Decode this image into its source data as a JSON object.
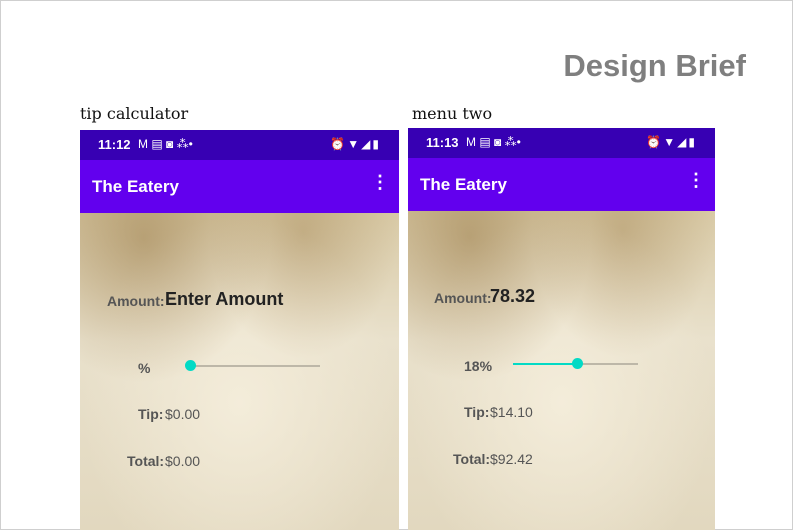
{
  "title": "Design Brief",
  "captions": {
    "left": "tip calculator",
    "right": "menu two"
  },
  "phones": [
    {
      "time": "11:12",
      "notif_icons": "M ▤ ◙ ⁂•",
      "sys_icons": "⏰▼◢▮",
      "app_title": "The Eatery",
      "menu_icon": "⋮",
      "amount_label": "Amount:",
      "amount_value": "Enter Amount",
      "percent_label": "%",
      "slider_fraction": 0,
      "tip_label": "Tip:",
      "tip_value": "$0.00",
      "total_label": "Total:",
      "total_value": "$0.00"
    },
    {
      "time": "11:13",
      "notif_icons": "M ▤ ◙ ⁂•",
      "sys_icons": "⏰▼◢▮",
      "app_title": "The Eatery",
      "menu_icon": "⋮",
      "amount_label": "Amount:",
      "amount_value": "78.32",
      "percent_label": "18%",
      "slider_fraction": 0.5,
      "tip_label": "Tip:",
      "tip_value": "$14.10",
      "total_label": "Total:",
      "total_value": "$92.42"
    }
  ],
  "colors": {
    "status_bar": "#3700b3",
    "app_bar": "#6200ee",
    "slider": "#03dac5"
  }
}
